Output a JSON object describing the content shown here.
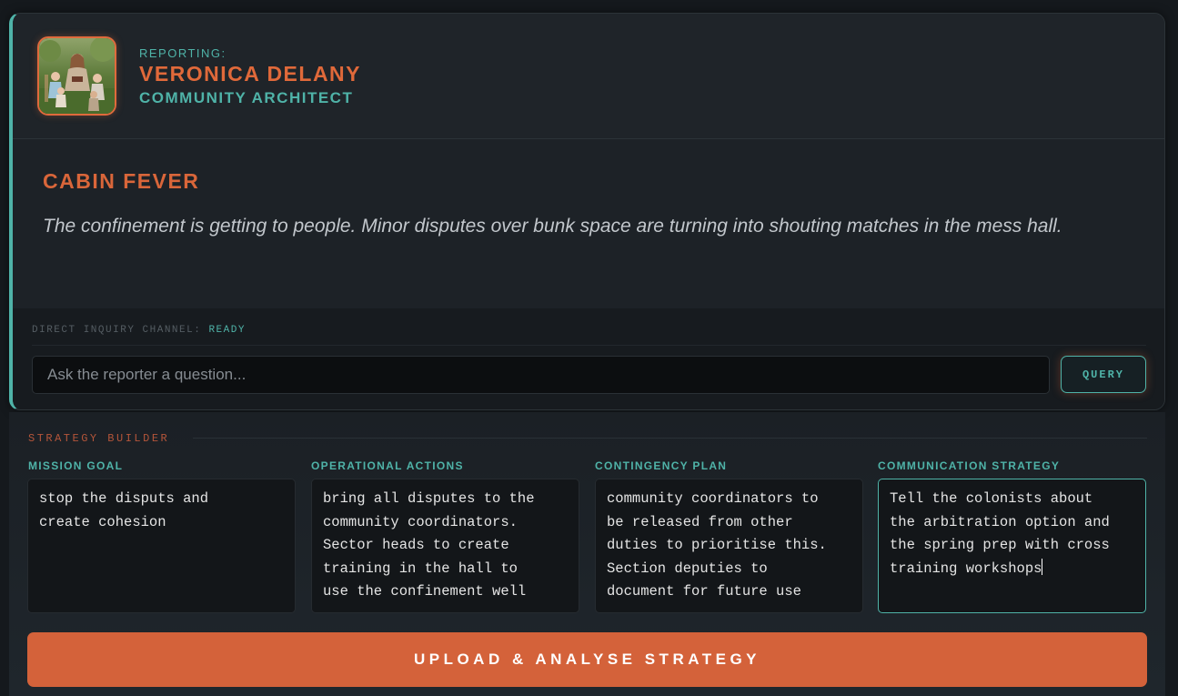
{
  "reporter": {
    "reporting_label": "REPORTING:",
    "name": "VERONICA DELANY",
    "role": "COMMUNITY ARCHITECT",
    "avatar_icon": "reporter-portrait"
  },
  "incident": {
    "title": "CABIN FEVER",
    "description": "The confinement is getting to people. Minor disputes over bunk space are turning into shouting matches in the mess hall."
  },
  "inquiry": {
    "channel_label": "DIRECT INQUIRY CHANNEL:",
    "status": "READY",
    "placeholder": "Ask the reporter a question...",
    "value": "",
    "query_label": "QUERY"
  },
  "strategy": {
    "section_label": "STRATEGY BUILDER",
    "fields": [
      {
        "label": "MISSION GOAL",
        "value": "stop the disputs and\ncreate cohesion"
      },
      {
        "label": "OPERATIONAL ACTIONS",
        "value": "bring all disputes to the\ncommunity coordinators.\nSector heads to create\ntraining in the hall to\nuse the confinement well"
      },
      {
        "label": "CONTINGENCY PLAN",
        "value": "community coordinators to\nbe released from other\nduties to prioritise this.\nSection deputies to\ndocument for future use"
      },
      {
        "label": "COMMUNICATION STRATEGY",
        "value": "Tell the colonists about\nthe arbitration option and\nthe spring prep with cross\ntraining workshops"
      }
    ],
    "submit_label": "UPLOAD & ANALYSE STRATEGY"
  },
  "colors": {
    "accent_teal": "#4fb3a8",
    "accent_orange": "#d4623a",
    "background": "#15191d"
  }
}
